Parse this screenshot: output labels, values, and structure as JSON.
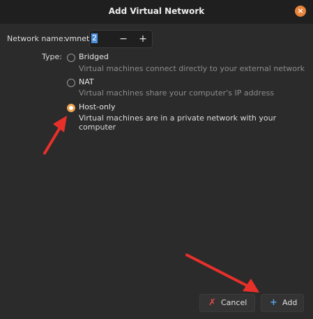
{
  "window": {
    "title": "Add Virtual Network",
    "close_symbol": "×"
  },
  "network_name": {
    "label": "Network name:",
    "prefix": "vmnet",
    "value": "2",
    "minus_symbol": "−",
    "plus_symbol": "+"
  },
  "type": {
    "label": "Type:",
    "options": [
      {
        "title": "Bridged",
        "description": "Virtual machines connect directly to your external network",
        "selected": false
      },
      {
        "title": "NAT",
        "description": "Virtual machines share your computer's IP address",
        "selected": false
      },
      {
        "title": "Host-only",
        "description": "Virtual machines are in a private network with your computer",
        "selected": true
      }
    ]
  },
  "buttons": {
    "cancel_label": "Cancel",
    "cancel_icon": "✗",
    "add_label": "Add",
    "add_icon": "+"
  },
  "colors": {
    "accent": "#f0a24d",
    "annotation_arrow": "#e8302a",
    "cancel_icon": "#e24a4a",
    "add_icon": "#5aa0e6"
  }
}
